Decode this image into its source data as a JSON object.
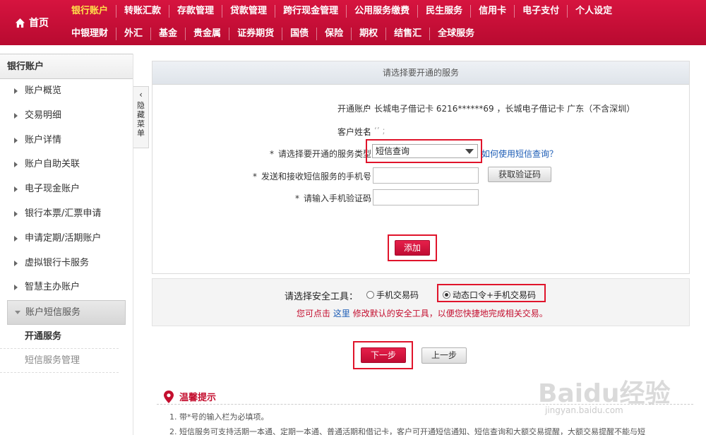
{
  "nav": {
    "home_label": "首页",
    "row1": [
      "银行账户",
      "转账汇款",
      "存款管理",
      "贷款管理",
      "跨行现金管理",
      "公用服务缴费",
      "民生服务",
      "信用卡",
      "电子支付",
      "个人设定"
    ],
    "row2": [
      "中银理财",
      "外汇",
      "基金",
      "贵金属",
      "证券期货",
      "国债",
      "保险",
      "期权",
      "结售汇",
      "全球服务"
    ],
    "active_item": "银行账户",
    "active_color": "#ffe04a",
    "brand_color": "#c8103a"
  },
  "sidebar": {
    "title": "银行账户",
    "items": [
      "账户概览",
      "交易明细",
      "账户详情",
      "账户自助关联",
      "电子现金账户",
      "银行本票/汇票申请",
      "申请定期/活期账户",
      "虚拟银行卡服务",
      "智慧主办账户"
    ],
    "open_item": "账户短信服务",
    "sub_items": [
      "开通服务",
      "短信服务管理"
    ],
    "collapse_tab": {
      "arrow": "‹",
      "text": "隐藏菜单"
    }
  },
  "form": {
    "header": "请选择要开通的服务",
    "colon": "：",
    "account_label": "开通账户",
    "account_value": "长城电子借记卡 6216******69   ，长城电子借记卡 广东（不含深圳）",
    "name_label": "客户姓名",
    "name_value": "‘’ ;",
    "service_type_label": "请选择要开通的服务类型",
    "service_type_value": "短信查询",
    "help_link": "如何使用短信查询？",
    "phone_label": "发送和接收短信服务的手机号",
    "phone_value": "",
    "get_code_button": "获取验证码",
    "code_label": "请输入手机验证码",
    "code_value": "",
    "required_mark": "*",
    "add_button": "添加"
  },
  "security": {
    "label": "请选择安全工具：",
    "options": [
      "手机交易码",
      "动态口令+手机交易码"
    ],
    "selected": "动态口令+手机交易码",
    "hint_prefix": "您可点击",
    "hint_link": "这里",
    "hint_suffix": "修改默认的安全工具，以便您快捷地完成相关交易。"
  },
  "buttons": {
    "next": "下一步",
    "prev": "上一步"
  },
  "tips": {
    "title": "温馨提示",
    "items": [
      "1. 带*号的输入栏为必填项。",
      "2. 短信服务可支持活期一本通、定期一本通、普通活期和借记卡，客户可开通短信通知、短信查询和大额交易提醒，大额交易提醒不能与短"
    ]
  },
  "watermark": {
    "main": "Baidu经验",
    "sub": "jingyan.baidu.com"
  }
}
